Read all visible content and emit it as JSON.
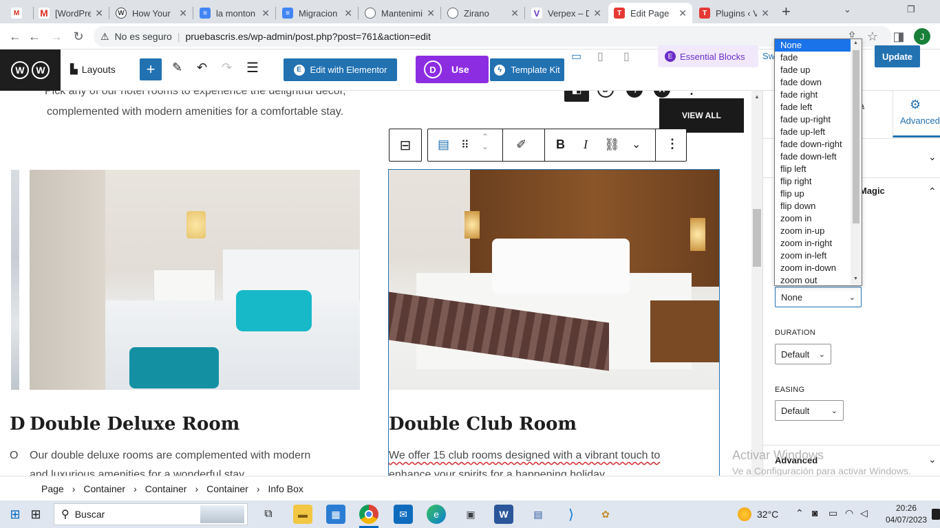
{
  "browser": {
    "tabs": [
      {
        "title": "",
        "color": "#d93025",
        "glyph": "M"
      },
      {
        "title": "[WordPres",
        "color": "#d93025",
        "glyph": "M"
      },
      {
        "title": "How Your",
        "color": "#3c4043",
        "glyph": "W"
      },
      {
        "title": "la monton",
        "color": "#4285f4",
        "glyph": "≡"
      },
      {
        "title": "Migracion",
        "color": "#4285f4",
        "glyph": "≡"
      },
      {
        "title": "Mantenimi",
        "color": "#5f6368",
        "glyph": "◐"
      },
      {
        "title": "Zirano",
        "color": "#5f6368",
        "glyph": "◐"
      },
      {
        "title": "Verpex – D",
        "color": "#6a3fc7",
        "glyph": "V"
      },
      {
        "title": "Edit Page",
        "color": "#e53935",
        "glyph": "T"
      },
      {
        "title": "Plugins ‹ V",
        "color": "#e53935",
        "glyph": "T"
      }
    ],
    "new_tab": "+",
    "security": "No es seguro",
    "url": "pruebascris.es/wp-admin/post.php?post=761&action=edit",
    "profile_initial": "J"
  },
  "wp": {
    "layouts": "Layouts",
    "elementor": "Edit with Elementor",
    "divi_use": "Use",
    "template_kit": "Template Kit",
    "essential_blocks": "Essential Blocks",
    "swi": "Swi",
    "update": "Update",
    "view_all": "VIEW ALL"
  },
  "content": {
    "intro_line1": "Pick any of our hotel rooms to experience the delightful decor,",
    "intro_line2": "complemented with modern amenities for a comfortable stay.",
    "room1_title": "Double Deluxe Room",
    "room1_desc1": "Our double deluxe rooms are complemented with modern",
    "room1_desc2": "and luxurious amenities for a wonderful stay.",
    "room2_title": "Double Club Room",
    "room2_desc1": "We offer 15 club rooms designed with a vibrant touch to",
    "room2_desc2": "enhance your spirits for a happening holiday.",
    "edge_d": "D",
    "edge_o": "O"
  },
  "sidebar": {
    "style_tab": "le",
    "advanced_tab": "Advanced",
    "magic": "nMagic",
    "animation_value": "None",
    "duration_label": "DURATION",
    "duration_value": "Default",
    "easing_label": "EASING",
    "easing_value": "Default",
    "advanced_section": "Advanced"
  },
  "dropdown": {
    "options": [
      "None",
      "fade",
      "fade up",
      "fade down",
      "fade right",
      "fade left",
      "fade up-right",
      "fade up-left",
      "fade down-right",
      "fade down-left",
      "flip left",
      "flip right",
      "flip up",
      "flip down",
      "zoom in",
      "zoom in-up",
      "zoom in-right",
      "zoom in-left",
      "zoom in-down",
      "zoom out"
    ],
    "selected": "None"
  },
  "watermark": {
    "line1": "Activar Windows",
    "line2": "Ve a Configuración para activar Windows."
  },
  "breadcrumbs": [
    "Page",
    "Container",
    "Container",
    "Container",
    "Info Box"
  ],
  "taskbar": {
    "search": "Buscar",
    "temperature": "32°C",
    "time": "20:26",
    "date": "04/07/2023"
  },
  "colors": {
    "accent": "#2271b1",
    "divi": "#8d2de2",
    "dark": "#1e1e1e"
  }
}
